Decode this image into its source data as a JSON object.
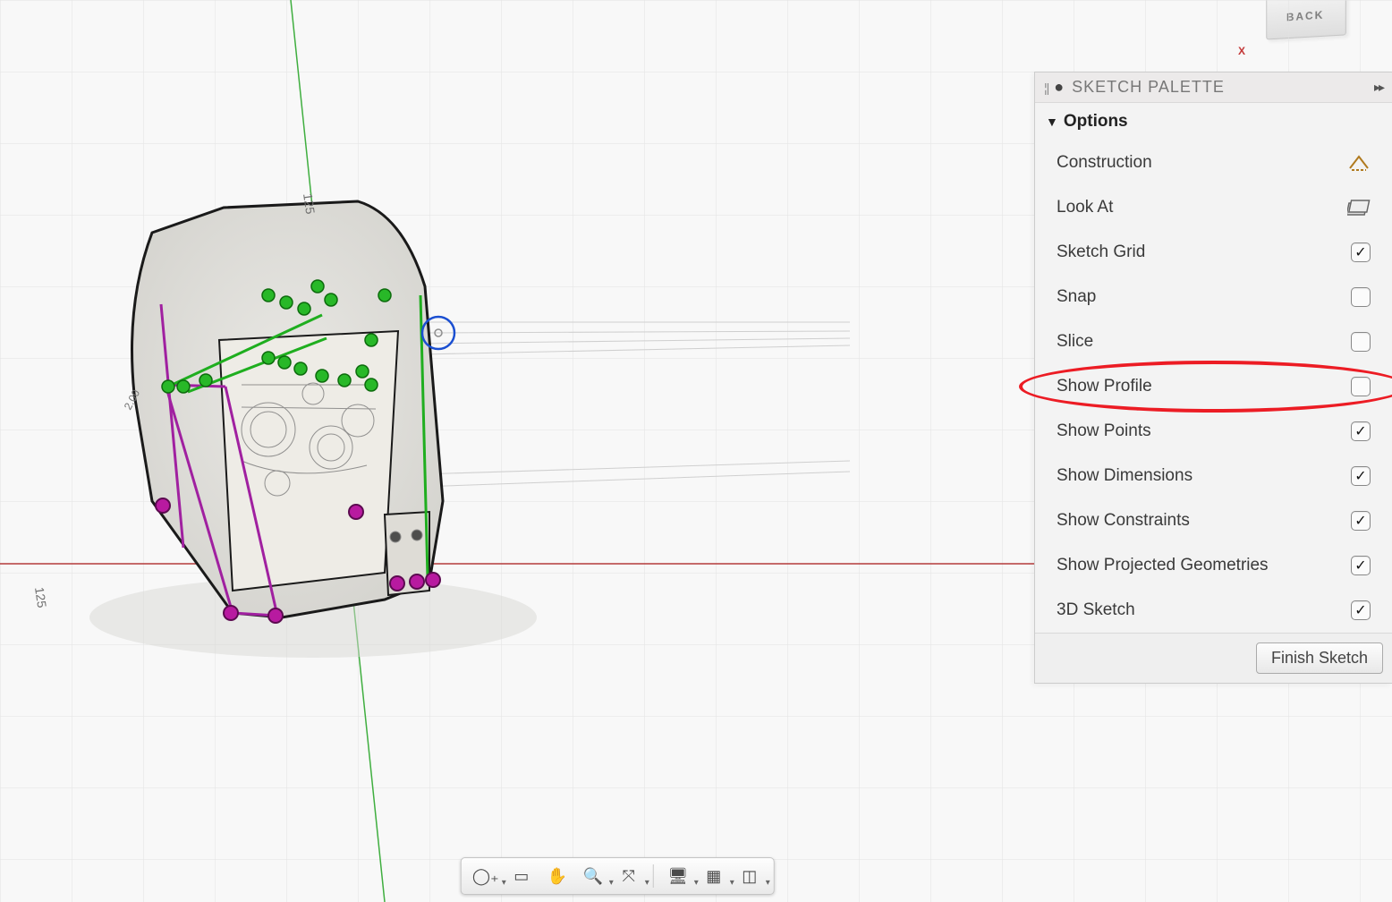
{
  "viewcube": {
    "face": "BACK",
    "axis_x": "X"
  },
  "canvas": {
    "dims": {
      "left_axis": "125",
      "right_axis": "125",
      "part_v": "2.00"
    }
  },
  "toolbar": {
    "items": [
      {
        "name": "orbit",
        "glyph": "◯₊",
        "dd": true
      },
      {
        "name": "lookat",
        "glyph": "▭",
        "dd": false
      },
      {
        "name": "pan",
        "glyph": "✋",
        "dd": false
      },
      {
        "name": "zoom",
        "glyph": "🔍",
        "dd": true
      },
      {
        "name": "fit",
        "glyph": "⤧",
        "dd": true
      }
    ],
    "display_items": [
      {
        "name": "visual-style",
        "glyph": "🖥",
        "dd": true
      },
      {
        "name": "grid-settings",
        "glyph": "▦",
        "dd": true
      },
      {
        "name": "viewports",
        "glyph": "◫",
        "dd": true
      }
    ]
  },
  "palette": {
    "title": "SKETCH PALETTE",
    "section": "Options",
    "options": [
      {
        "key": "construction",
        "label": "Construction",
        "type": "icon",
        "icon": "construction"
      },
      {
        "key": "look-at",
        "label": "Look At",
        "type": "icon",
        "icon": "lookat"
      },
      {
        "key": "sketch-grid",
        "label": "Sketch Grid",
        "type": "check",
        "checked": true
      },
      {
        "key": "snap",
        "label": "Snap",
        "type": "check",
        "checked": false
      },
      {
        "key": "slice",
        "label": "Slice",
        "type": "check",
        "checked": false
      },
      {
        "key": "show-profile",
        "label": "Show Profile",
        "type": "check",
        "checked": false,
        "highlight": true
      },
      {
        "key": "show-points",
        "label": "Show Points",
        "type": "check",
        "checked": true
      },
      {
        "key": "show-dimensions",
        "label": "Show Dimensions",
        "type": "check",
        "checked": true
      },
      {
        "key": "show-constraints",
        "label": "Show Constraints",
        "type": "check",
        "checked": true
      },
      {
        "key": "show-projected",
        "label": "Show Projected Geometries",
        "type": "check",
        "checked": true
      },
      {
        "key": "3d-sketch",
        "label": "3D Sketch",
        "type": "check",
        "checked": true
      }
    ],
    "footer_button": "Finish Sketch"
  }
}
